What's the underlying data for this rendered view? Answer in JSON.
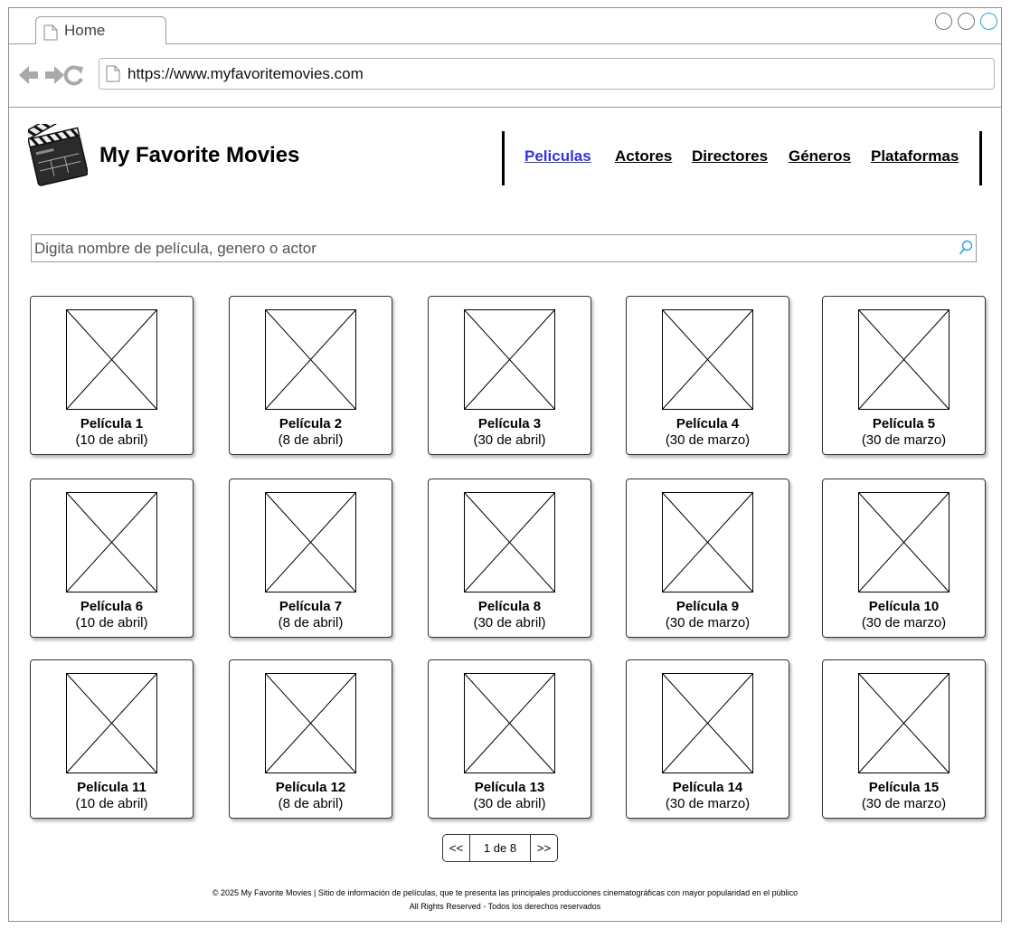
{
  "browser": {
    "tab_label": "Home",
    "url": "https://www.myfavoritemovies.com"
  },
  "site": {
    "title": "My Favorite Movies"
  },
  "nav": {
    "items": [
      {
        "label": "Peliculas",
        "active": true
      },
      {
        "label": "Actores",
        "active": false
      },
      {
        "label": "Directores",
        "active": false
      },
      {
        "label": "Géneros",
        "active": false
      },
      {
        "label": "Plataformas",
        "active": false
      }
    ]
  },
  "search": {
    "placeholder": "Digita nombre de película, genero o actor"
  },
  "movies": [
    {
      "title": "Película 1",
      "date": "(10 de abril)"
    },
    {
      "title": "Película 2",
      "date": "(8 de abril)"
    },
    {
      "title": "Película 3",
      "date": "(30 de abril)"
    },
    {
      "title": "Película 4",
      "date": "(30 de marzo)"
    },
    {
      "title": "Película 5",
      "date": "(30 de marzo)"
    },
    {
      "title": "Película 6",
      "date": "(10 de abril)"
    },
    {
      "title": "Película 7",
      "date": "(8 de abril)"
    },
    {
      "title": "Película 8",
      "date": "(30 de abril)"
    },
    {
      "title": "Película 9",
      "date": "(30 de marzo)"
    },
    {
      "title": "Película 10",
      "date": "(30 de marzo)"
    },
    {
      "title": "Película 11",
      "date": "(10 de abril)"
    },
    {
      "title": "Película 12",
      "date": "(8 de abril)"
    },
    {
      "title": "Película 13",
      "date": "(30 de abril)"
    },
    {
      "title": "Película 14",
      "date": "(30 de marzo)"
    },
    {
      "title": "Película 15",
      "date": "(30 de marzo)"
    }
  ],
  "pagination": {
    "prev": "<<",
    "page": "1 de 8",
    "next": ">>"
  },
  "footer": {
    "line1": "© 2025 My Favorite Movies | Sitio de información de películas, que te presenta las principales producciones cinematográficas con mayor popularidad en el público",
    "line2": "All Rights Reserved - Todos los derechos reservados"
  },
  "colors": {
    "active_link": "#3333dd",
    "window_button_accent": "#29a3e0"
  }
}
